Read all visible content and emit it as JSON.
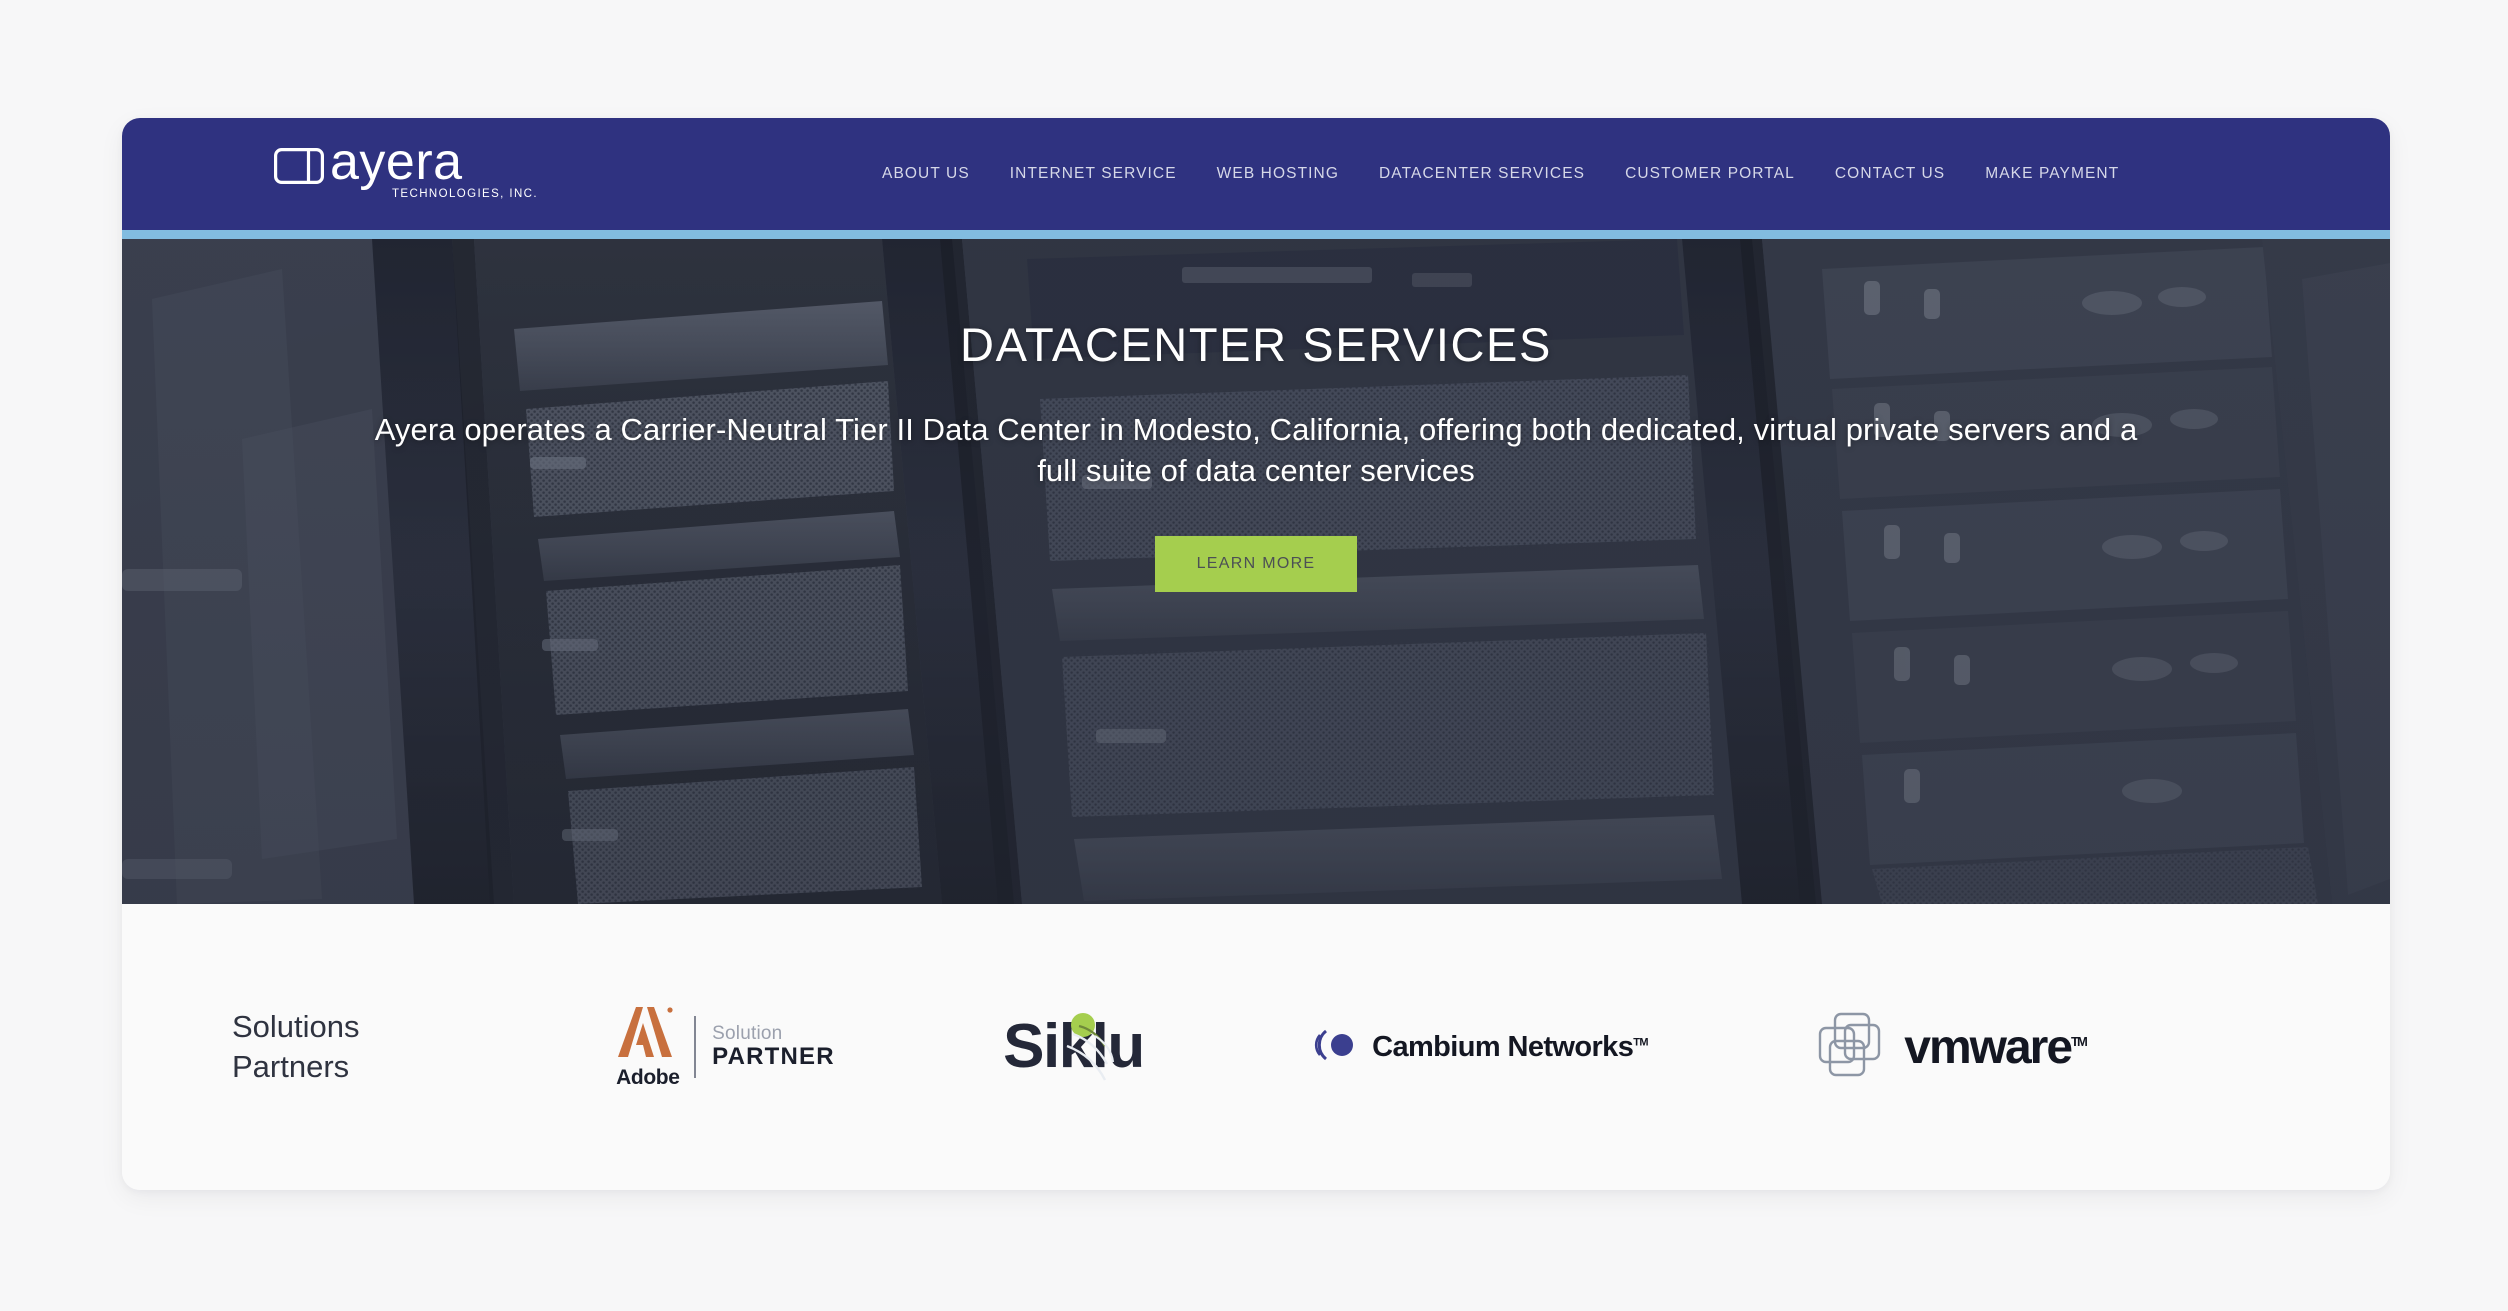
{
  "theme": {
    "nav_bg": "#2f3280",
    "nav_accent": "#82bce0",
    "cta_bg": "#a5ce4e",
    "cta_text": "#4c5055",
    "page_bg": "#f7f7f8",
    "section_bg": "#fafafa",
    "hero_overlay": "#2a2e3c"
  },
  "header": {
    "logo": {
      "wordmark": "ayera",
      "tagline": "TECHNOLOGIES, INC.",
      "mark_name": "ayera-logo-mark"
    },
    "nav_items": [
      {
        "label": "ABOUT US",
        "name": "nav-item-about-us"
      },
      {
        "label": "INTERNET SERVICE",
        "name": "nav-item-internet-service"
      },
      {
        "label": "WEB HOSTING",
        "name": "nav-item-web-hosting"
      },
      {
        "label": "DATACENTER SERVICES",
        "name": "nav-item-datacenter-services"
      },
      {
        "label": "CUSTOMER PORTAL",
        "name": "nav-item-customer-portal"
      },
      {
        "label": "CONTACT US",
        "name": "nav-item-contact-us"
      },
      {
        "label": "MAKE PAYMENT",
        "name": "nav-item-make-payment"
      }
    ]
  },
  "hero": {
    "title": "DATACENTER SERVICES",
    "subtitle": "Ayera operates a Carrier-Neutral Tier II Data Center in Modesto, California, offering both dedicated, virtual private servers and a full suite of data center services",
    "cta_label": "LEARN MORE",
    "background_name": "server-rack-photo"
  },
  "partners": {
    "heading_line1": "Solutions",
    "heading_line2": "Partners",
    "logos": [
      {
        "name": "adobe-solution-partner-logo",
        "brand": "Adobe",
        "line1": "Solution",
        "line2": "PARTNER",
        "accent": "#c8703e"
      },
      {
        "name": "siklu-logo",
        "brand": "Siklu",
        "accent": "#a5ce4e"
      },
      {
        "name": "cambium-networks-logo",
        "brand": "Cambium Networks",
        "trademark": "TM",
        "accent": "#3b3f8f"
      },
      {
        "name": "vmware-logo",
        "brand": "vmware",
        "trademark": "TM",
        "accent": "#8d96a5"
      }
    ]
  }
}
